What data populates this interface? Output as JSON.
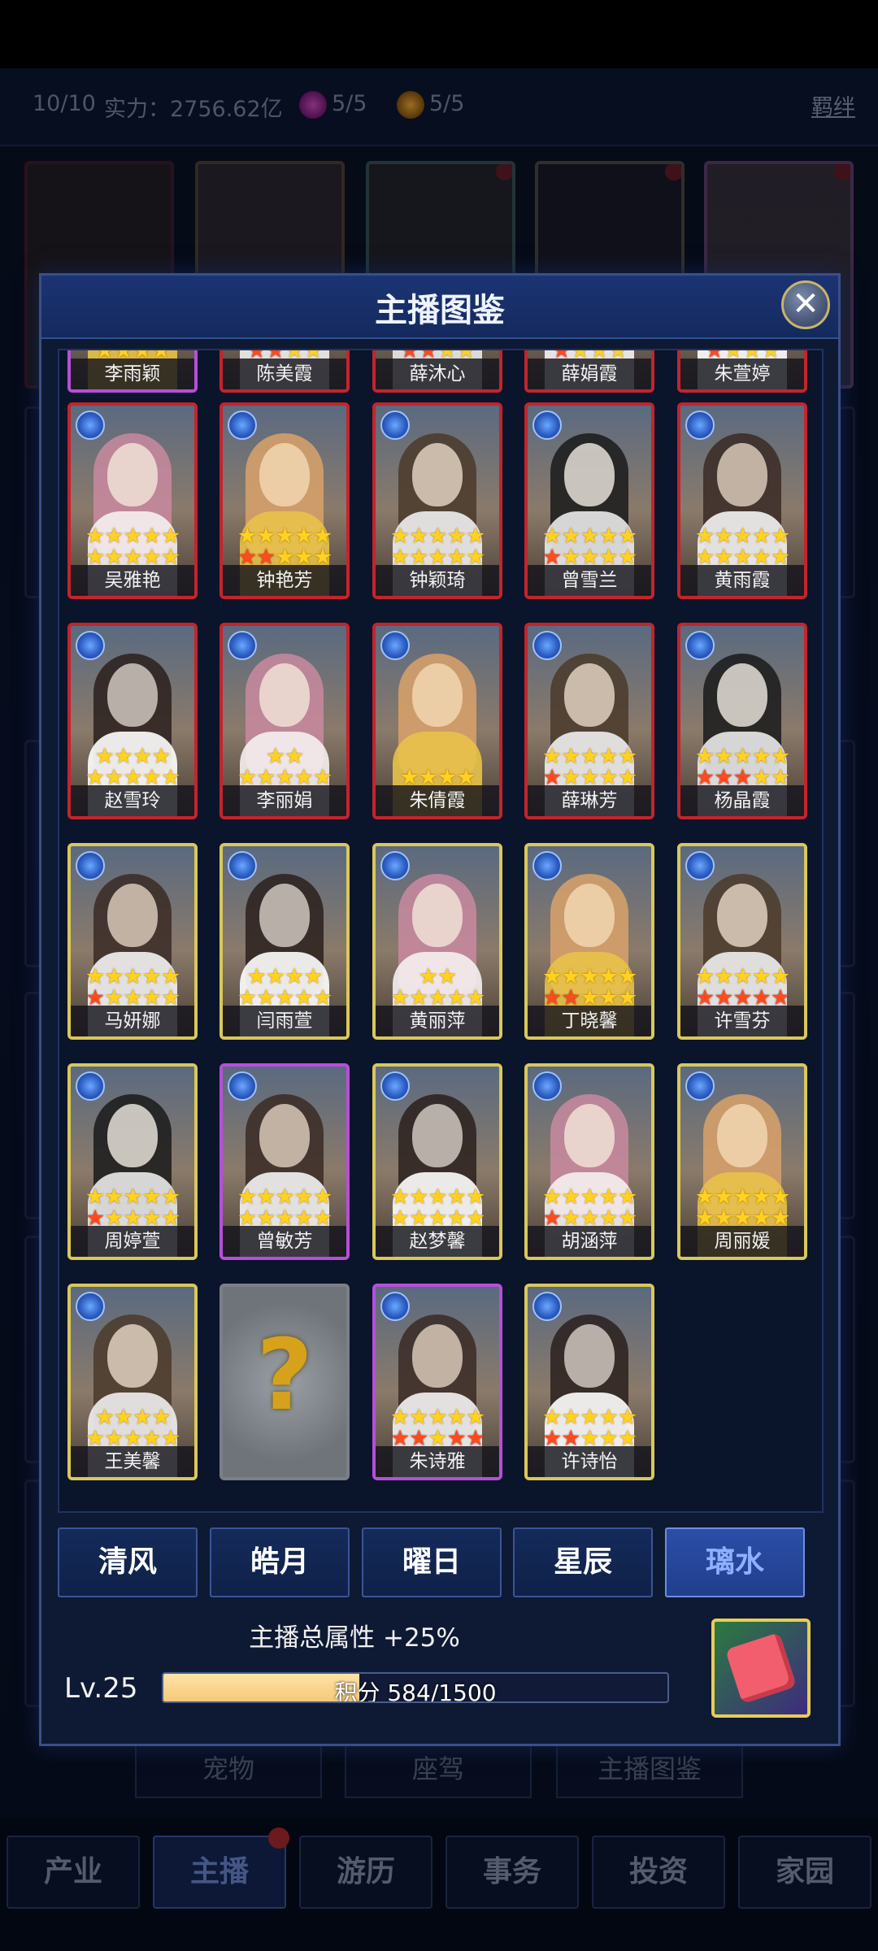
{
  "top_bar": {
    "count": "10/10",
    "power": "实力：2756.62亿",
    "badge_a": "5/5",
    "badge_b": "5/5",
    "bond_link": "羁绊"
  },
  "modal": {
    "title": "主播图鉴",
    "close": "✕",
    "cards": [
      {
        "name": "李雨颖",
        "border": "purple",
        "s1": "",
        "s2": "yyyy"
      },
      {
        "name": "陈美霞",
        "border": "red",
        "s1": "",
        "s2": "rryy"
      },
      {
        "name": "薛沐心",
        "border": "red",
        "s1": "",
        "s2": "rryy"
      },
      {
        "name": "薛娟霞",
        "border": "red",
        "s1": "",
        "s2": "ryyy"
      },
      {
        "name": "朱萱婷",
        "border": "red",
        "s1": "",
        "s2": "ryyy"
      },
      {
        "name": "吴雅艳",
        "border": "red",
        "s1": "yyyyy",
        "s2": "yyyyy"
      },
      {
        "name": "钟艳芳",
        "border": "red",
        "s1": "yyyyy",
        "s2": "rryyy"
      },
      {
        "name": "钟颖琦",
        "border": "red",
        "s1": "yyyyy",
        "s2": "yyyyy"
      },
      {
        "name": "曾雪兰",
        "border": "red",
        "s1": "yyyyy",
        "s2": "ryyyy"
      },
      {
        "name": "黄雨霞",
        "border": "red",
        "s1": "yyyyy",
        "s2": "yyyyy"
      },
      {
        "name": "赵雪玲",
        "border": "red",
        "s1": "yyyy",
        "s2": "yyyyy"
      },
      {
        "name": "李丽娟",
        "border": "red",
        "s1": "yy",
        "s2": "yyyyy"
      },
      {
        "name": "朱倩霞",
        "border": "red",
        "s1": "",
        "s2": "yyyy"
      },
      {
        "name": "薛琳芳",
        "border": "red",
        "s1": "yyyyy",
        "s2": "ryyyy"
      },
      {
        "name": "杨晶霞",
        "border": "red",
        "s1": "yyyyy",
        "s2": "rrryy"
      },
      {
        "name": "马妍娜",
        "border": "gold",
        "s1": "yyyyy",
        "s2": "ryyyy"
      },
      {
        "name": "闫雨萱",
        "border": "gold",
        "s1": "yyyy",
        "s2": "yyyyy"
      },
      {
        "name": "黄丽萍",
        "border": "gold",
        "s1": "yy",
        "s2": "yyyyy"
      },
      {
        "name": "丁晓馨",
        "border": "gold",
        "s1": "yyyyy",
        "s2": "rryyy"
      },
      {
        "name": "许雪芬",
        "border": "gold",
        "s1": "yyyyy",
        "s2": "rrrrr"
      },
      {
        "name": "周婷萱",
        "border": "gold",
        "s1": "yyyyy",
        "s2": "ryyyy"
      },
      {
        "name": "曾敏芳",
        "border": "purple",
        "s1": "yyyyy",
        "s2": "yyyyy"
      },
      {
        "name": "赵梦馨",
        "border": "gold",
        "s1": "yyyyy",
        "s2": "yyyyy"
      },
      {
        "name": "胡涵萍",
        "border": "gold",
        "s1": "yyyyy",
        "s2": "ryyyy"
      },
      {
        "name": "周丽媛",
        "border": "gold",
        "s1": "yyyyy",
        "s2": "yyyyy"
      },
      {
        "name": "王美馨",
        "border": "gold",
        "s1": "yyyy",
        "s2": "yyyyy"
      },
      {
        "name": "",
        "border": "grey",
        "s1": "",
        "s2": "",
        "locked": true,
        "qmark": "?"
      },
      {
        "name": "朱诗雅",
        "border": "purple",
        "s1": "yyyyy",
        "s2": "rryrr"
      },
      {
        "name": "许诗怡",
        "border": "gold",
        "s1": "yyyyy",
        "s2": "rryyy"
      }
    ],
    "categories": [
      {
        "label": "清风",
        "active": false
      },
      {
        "label": "皓月",
        "active": false
      },
      {
        "label": "曜日",
        "active": false
      },
      {
        "label": "星辰",
        "active": false
      },
      {
        "label": "璃水",
        "active": true
      }
    ],
    "attr_text": "主播总属性 +25%",
    "level": "Lv.25",
    "progress_text": "积分 584/1500",
    "progress_fraction": 0.389
  },
  "background_tabs": [
    "宠物",
    "座驾",
    "主播图鉴"
  ],
  "bottom_nav": [
    {
      "label": "产业",
      "active": false
    },
    {
      "label": "主播",
      "active": true
    },
    {
      "label": "游历",
      "active": false
    },
    {
      "label": "事务",
      "active": false
    },
    {
      "label": "投资",
      "active": false
    },
    {
      "label": "家园",
      "active": false
    }
  ],
  "colors": {
    "border_red": "#c4242c",
    "border_gold": "#d9c85a",
    "border_purple": "#b64fd8",
    "star_yellow": "#ffd21f",
    "star_red": "#ff4a1c",
    "accent_blue": "#2c4ea8"
  }
}
